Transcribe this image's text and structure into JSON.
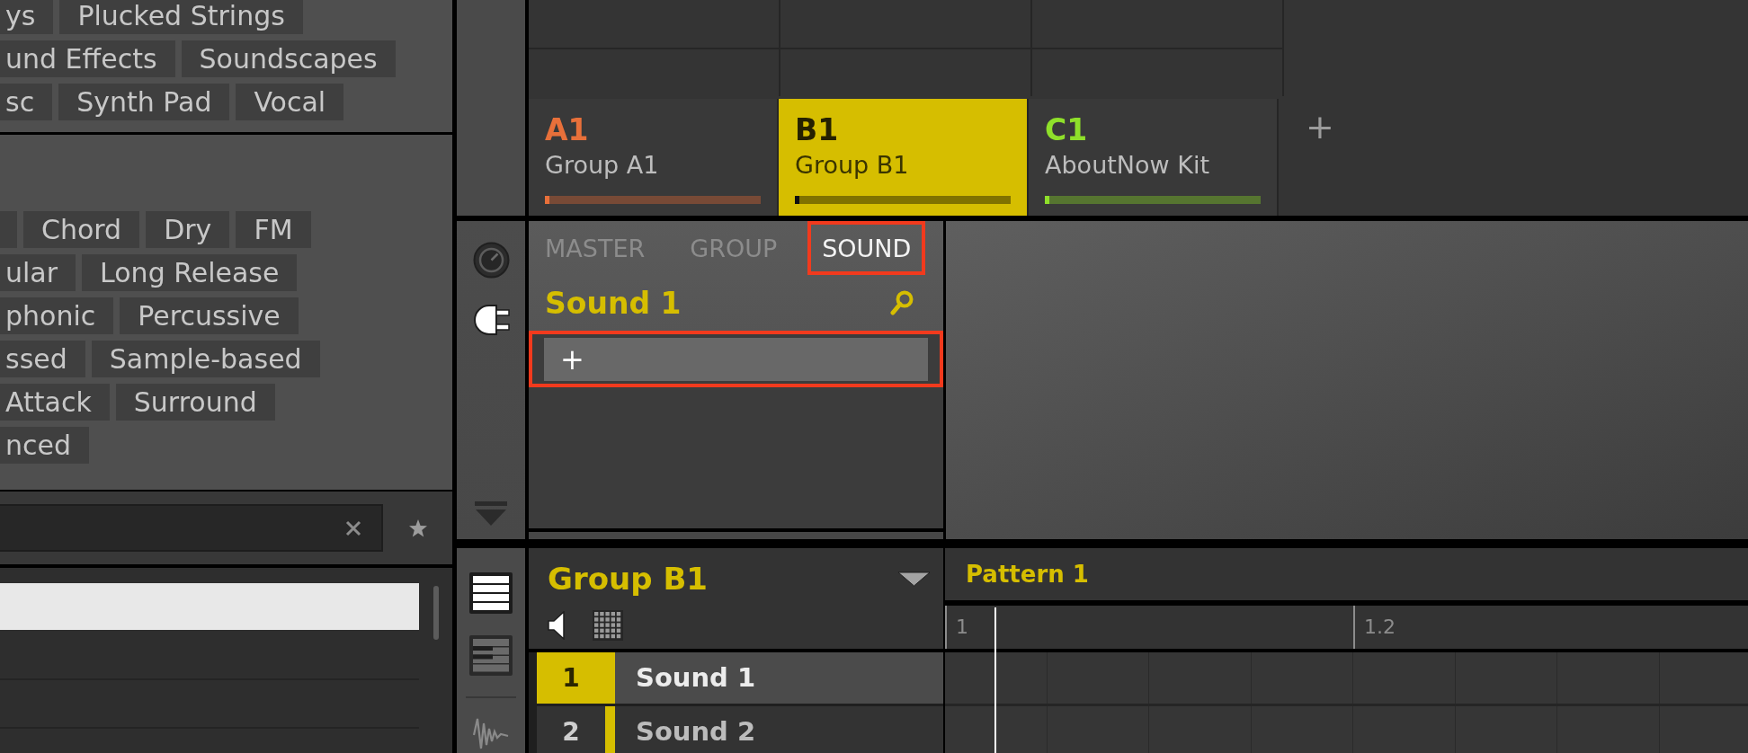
{
  "browser": {
    "tag_sections": [
      {
        "rows": [
          [
            {
              "kind": "clipped",
              "label": "ys"
            },
            {
              "kind": "full",
              "label": "Plucked Strings"
            }
          ],
          [
            {
              "kind": "clipped",
              "label": "und Effects"
            },
            {
              "kind": "full",
              "label": "Soundscapes"
            }
          ],
          [
            {
              "kind": "clipped",
              "label": "sc"
            },
            {
              "kind": "full",
              "label": "Synth Pad"
            },
            {
              "kind": "full",
              "label": "Vocal"
            }
          ]
        ]
      },
      {
        "rows": [
          [
            {
              "kind": "clipped"
            },
            {
              "kind": "full",
              "label": "Chord"
            },
            {
              "kind": "full",
              "label": "Dry"
            },
            {
              "kind": "full",
              "label": "FM"
            }
          ],
          [
            {
              "kind": "clipped",
              "label": "ular"
            },
            {
              "kind": "full",
              "label": "Long Release"
            }
          ],
          [
            {
              "kind": "clipped",
              "label": "phonic"
            },
            {
              "kind": "full",
              "label": "Percussive"
            }
          ],
          [
            {
              "kind": "clipped",
              "label": "ssed"
            },
            {
              "kind": "full",
              "label": "Sample-based"
            }
          ],
          [
            {
              "kind": "clipped",
              "label": "Attack"
            },
            {
              "kind": "full",
              "label": "Surround"
            }
          ],
          [
            {
              "kind": "clipped",
              "label": "nced"
            }
          ]
        ]
      }
    ],
    "results": [
      {
        "selected": true
      },
      {
        "selected": false
      },
      {
        "selected": false
      }
    ]
  },
  "groups": [
    {
      "label": "A1",
      "name": "Group A1",
      "color": "#e8703a",
      "selected": false
    },
    {
      "label": "B1",
      "name": "Group B1",
      "color": "#d6be00",
      "selected": true
    },
    {
      "label": "C1",
      "name": "AboutNow Kit",
      "color": "#8fe02a",
      "selected": false
    }
  ],
  "add_group": "+",
  "sound_panel": {
    "modes": [
      {
        "kind": "knob",
        "selected": false
      },
      {
        "kind": "plug",
        "selected": true
      }
    ],
    "tabs": [
      {
        "label": "MASTER",
        "selected": false,
        "highlighted": false
      },
      {
        "label": "GROUP",
        "selected": false,
        "highlighted": false
      },
      {
        "label": "SOUND",
        "selected": true,
        "highlighted": true
      }
    ],
    "title": "Sound 1",
    "slot": {
      "label": "+",
      "highlighted": true
    }
  },
  "group_editor": {
    "views": [
      {
        "kind": "list",
        "selected": true
      },
      {
        "kind": "keyboard",
        "selected": false
      },
      {
        "kind": "waveform",
        "selected": false
      }
    ],
    "title": "Group B1",
    "tools": [
      {
        "kind": "speaker",
        "selected": true
      },
      {
        "kind": "pads",
        "selected": false
      }
    ],
    "sounds": [
      {
        "index": "1",
        "name": "Sound 1",
        "selected": true
      },
      {
        "index": "2",
        "name": "Sound 2",
        "selected": false
      }
    ]
  },
  "pattern_editor": {
    "title": "Pattern 1",
    "ruler": [
      "1",
      "1.2"
    ]
  }
}
